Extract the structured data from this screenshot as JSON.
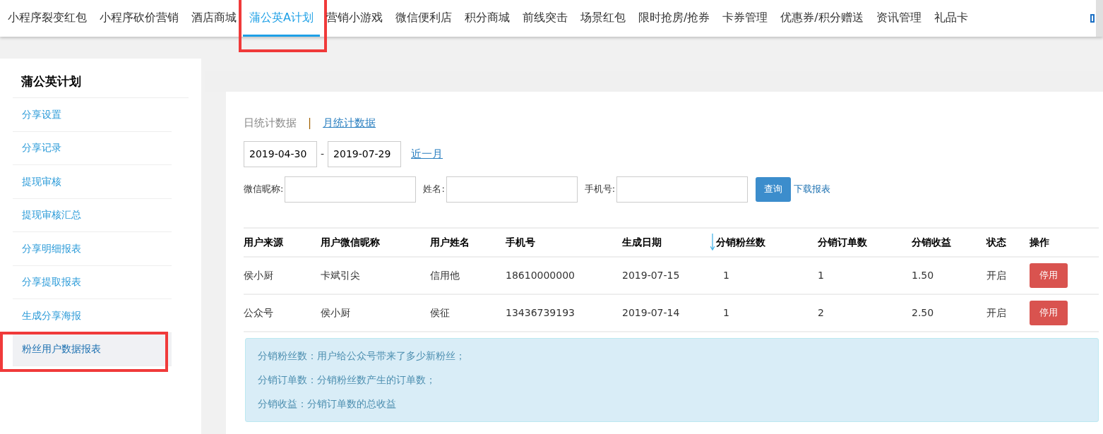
{
  "top_nav": [
    {
      "label": "小程序裂变红包",
      "selected": false,
      "annotated": false
    },
    {
      "label": "小程序砍价营销",
      "selected": false,
      "annotated": false
    },
    {
      "label": "酒店商城",
      "selected": false,
      "annotated": false
    },
    {
      "label": "蒲公英A计划",
      "selected": true,
      "annotated": true
    },
    {
      "label": "营销小游戏",
      "selected": false,
      "annotated": false
    },
    {
      "label": "微信便利店",
      "selected": false,
      "annotated": false
    },
    {
      "label": "积分商城",
      "selected": false,
      "annotated": false
    },
    {
      "label": "前线突击",
      "selected": false,
      "annotated": false
    },
    {
      "label": "场景红包",
      "selected": false,
      "annotated": false
    },
    {
      "label": "限时抢房/抢券",
      "selected": false,
      "annotated": false
    },
    {
      "label": "卡券管理",
      "selected": false,
      "annotated": false
    },
    {
      "label": "优惠券/积分赠送",
      "selected": false,
      "annotated": false
    },
    {
      "label": "资讯管理",
      "selected": false,
      "annotated": false
    },
    {
      "label": "礼品卡",
      "selected": false,
      "annotated": false
    }
  ],
  "sidebar": {
    "title": "蒲公英计划",
    "items": [
      {
        "label": "分享设置",
        "selected": false,
        "annotated": false
      },
      {
        "label": "分享记录",
        "selected": false,
        "annotated": false
      },
      {
        "label": "提现审核",
        "selected": false,
        "annotated": false
      },
      {
        "label": "提现审核汇总",
        "selected": false,
        "annotated": false
      },
      {
        "label": "分享明细报表",
        "selected": false,
        "annotated": false
      },
      {
        "label": "分享提取报表",
        "selected": false,
        "annotated": false
      },
      {
        "label": "生成分享海报",
        "selected": false,
        "annotated": false
      },
      {
        "label": "粉丝用户数据报表",
        "selected": true,
        "annotated": true
      }
    ]
  },
  "stats_tabs": {
    "items": [
      {
        "label": "日统计数据",
        "selected": true
      },
      {
        "label": "月统计数据",
        "selected": false
      }
    ],
    "separator": "|"
  },
  "date_range": {
    "start": "2019-04-30",
    "separator": "-",
    "end": "2019-07-29",
    "quick_link": "近一月"
  },
  "filters": [
    {
      "label": "微信昵称:"
    },
    {
      "label": "姓名:"
    },
    {
      "label": "手机号:"
    }
  ],
  "query_button": "查询",
  "download_link": "下载报表",
  "table": {
    "columns": [
      {
        "label": "用户来源",
        "sorted": false
      },
      {
        "label": "用户微信昵称",
        "sorted": false
      },
      {
        "label": "用户姓名",
        "sorted": false
      },
      {
        "label": "手机号",
        "sorted": false
      },
      {
        "label": "生成日期",
        "sorted": false
      },
      {
        "label": "分销粉丝数",
        "sorted": true
      },
      {
        "label": "分销订单数",
        "sorted": false
      },
      {
        "label": "分销收益",
        "sorted": false
      },
      {
        "label": "状态",
        "sorted": false
      },
      {
        "label": "操作",
        "sorted": false
      }
    ],
    "rows": [
      {
        "cells": [
          "侯小厨",
          "卡斌引尖",
          "信用他",
          "18610000000",
          "2019-07-15",
          "1",
          "1",
          "1.50",
          "开启"
        ],
        "action": "停用"
      },
      {
        "cells": [
          "公众号",
          "侯小厨",
          "侯征",
          "13436739193",
          "2019-07-14",
          "1",
          "2",
          "2.50",
          "开启"
        ],
        "action": "停用"
      }
    ]
  },
  "notes": [
    "分销粉丝数：用户给公众号带来了多少新粉丝；",
    "分销订单数：分销粉丝数产生的订单数；",
    "分销收益：分销订单数的总收益"
  ]
}
